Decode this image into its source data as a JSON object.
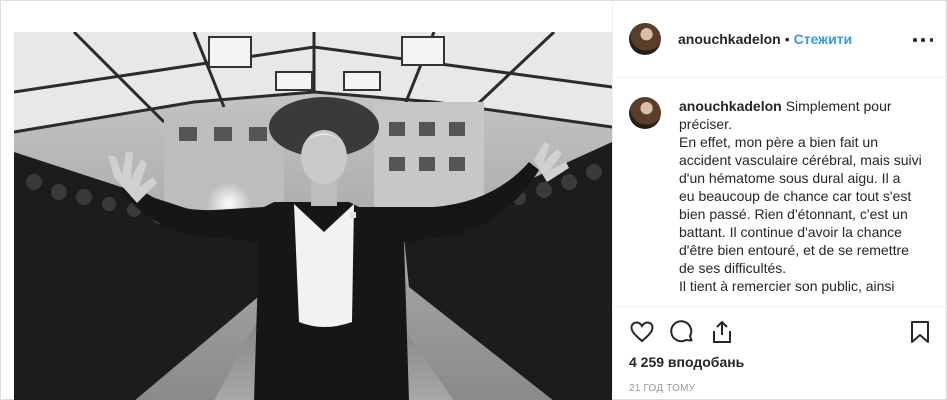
{
  "post": {
    "username": "anouchkadelon",
    "dot": "•",
    "follow_label": "Стежити",
    "caption_lines": [
      "Simplement pour",
      "préciser.",
      "En effet, mon père a bien fait un",
      "accident vasculaire cérébral, mais suivi",
      "d'un hématome sous dural aigu. Il a",
      "eu beaucoup de chance car tout s'est",
      "bien passé. Rien d'étonnant, c'est un",
      "battant. Il continue d'avoir la chance",
      "d'être bien entouré, et de se remettre",
      "de ses difficultés.",
      "Il tient à remercier son public, ainsi"
    ],
    "likes_text": "4 259 вподобань",
    "time_text": "21 год тому"
  },
  "icons": {
    "more": "more-options-icon",
    "like": "heart-icon",
    "comment": "comment-icon",
    "share": "share-icon",
    "save": "bookmark-icon"
  },
  "colors": {
    "link_blue": "#3897f0",
    "text": "#262626",
    "muted": "#999999",
    "border": "#dbdbdb"
  }
}
